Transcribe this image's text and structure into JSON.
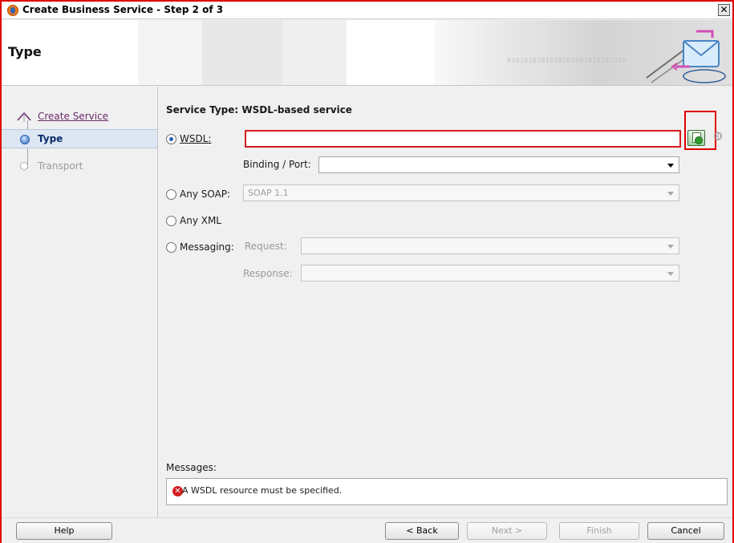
{
  "window": {
    "title": "Create Business Service - Step 2 of 3",
    "close_glyph": "✕"
  },
  "header": {
    "title": "Type",
    "binary_text": "0101010101010101001010101010"
  },
  "steps": [
    {
      "label": "Create Service",
      "state": "completed"
    },
    {
      "label": "Type",
      "state": "current"
    },
    {
      "label": "Transport",
      "state": "future"
    }
  ],
  "main": {
    "section_title": "Service Type: WSDL-based service",
    "wsdl": {
      "label": "WSDL:",
      "value": "",
      "selected": true
    },
    "binding_port": {
      "label": "Binding / Port:",
      "value": ""
    },
    "any_soap": {
      "label": "Any SOAP:",
      "value": "SOAP 1.1"
    },
    "any_xml": {
      "label": "Any XML"
    },
    "messaging": {
      "label": "Messaging:",
      "request_label": "Request:",
      "response_label": "Response:"
    },
    "messages_label": "Messages:",
    "message_text": "A WSDL resource must be specified."
  },
  "buttons": {
    "help": "Help",
    "back": "< Back",
    "next": "Next >",
    "finish": "Finish",
    "cancel": "Cancel"
  },
  "icons": {
    "browse": "browse-resource-icon",
    "service_gear": "gear-icon",
    "error": "error-icon"
  },
  "colors": {
    "accent_red": "#e00000",
    "selection_blue": "#dde7f3",
    "link_purple": "#6b2a6b"
  }
}
